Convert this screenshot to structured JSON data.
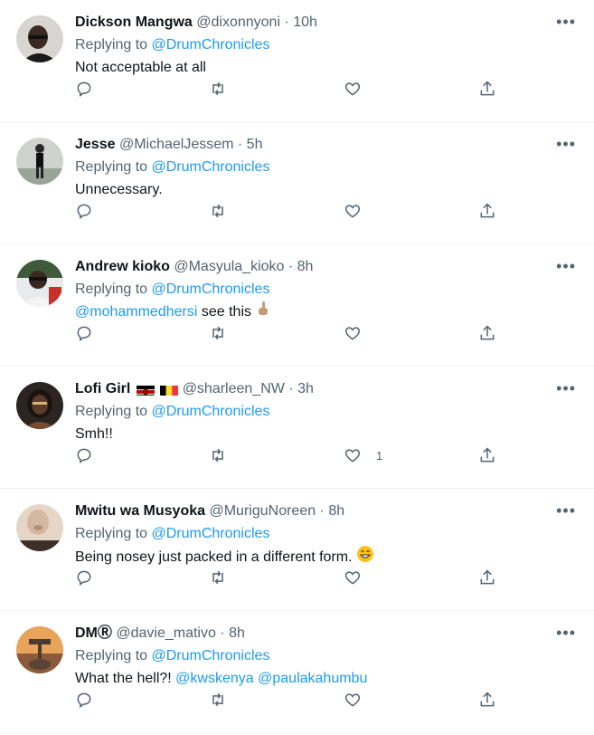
{
  "replies": [
    {
      "name": "Dickson Mangwa",
      "handle": "@dixonnyoni",
      "sep": " · ",
      "time": "10h",
      "replying_label": "Replying to",
      "replying_to": "@DrumChronicles",
      "text": "Not acceptable at all",
      "likes": ""
    },
    {
      "name": "Jesse",
      "handle": "@MichaelJessem",
      "sep": " · ",
      "time": "5h",
      "replying_label": "Replying to",
      "replying_to": "@DrumChronicles",
      "text": "Unnecessary.",
      "likes": ""
    },
    {
      "name": "Andrew kioko",
      "handle": "@Masyula_kioko",
      "sep": " · ",
      "time": "8h",
      "replying_label": "Replying to",
      "replying_to": "@DrumChronicles",
      "mention": "@mohammedhersi",
      "text": " see this",
      "likes": ""
    },
    {
      "name": "Lofi Girl",
      "handle": "@sharleen_NW",
      "sep": " · ",
      "time": "3h",
      "replying_label": "Replying to",
      "replying_to": "@DrumChronicles",
      "text": "Smh!!",
      "likes": "1"
    },
    {
      "name": "Mwitu wa Musyoka",
      "handle": "@MuriguNoreen",
      "sep": " · ",
      "time": "8h",
      "replying_label": "Replying to",
      "replying_to": "@DrumChronicles",
      "text": "Being nosey just packed in a different form.",
      "likes": ""
    },
    {
      "name": "DMⓇ",
      "handle": "@davie_mativo",
      "sep": " · ",
      "time": "8h",
      "replying_label": "Replying to",
      "replying_to": "@DrumChronicles",
      "text": "What the hell?! ",
      "mention": "@kwskenya",
      "mention2": "@paulakahumbu",
      "likes": ""
    }
  ],
  "more_label": "•••",
  "icons": {
    "reply": "reply-icon",
    "retweet": "retweet-icon",
    "like": "heart-icon",
    "share": "share-icon",
    "more": "more-icon"
  },
  "colors": {
    "link": "#1d9bf0",
    "muted": "#536471",
    "text": "#0f1419",
    "divider": "#eff3f4"
  }
}
